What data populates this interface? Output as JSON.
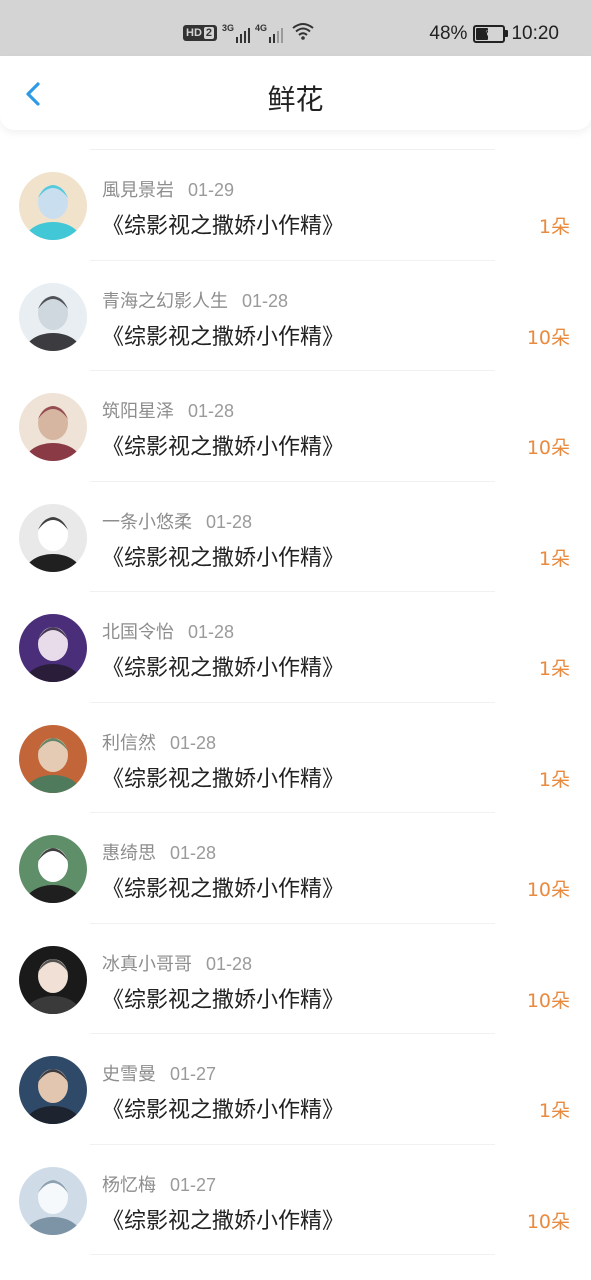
{
  "status_bar": {
    "hd_label": "HD",
    "hd_num": "2",
    "net1": "3G",
    "net2": "4G",
    "battery_pct": "48%",
    "battery_level": 0.48,
    "time": "10:20"
  },
  "header": {
    "title": "鲜花",
    "back_icon": "chevron-left-icon"
  },
  "accent_colors": {
    "back": "#2f9ae4",
    "count": "#e98a3f"
  },
  "items": [
    {
      "name": "風見景岩",
      "date": "01-29",
      "book": "《综影视之撒娇小作精》",
      "count": "1朵",
      "avatar_colors": [
        "#f1e2cc",
        "#c9dff0",
        "#41c7d6"
      ]
    },
    {
      "name": "青海之幻影人生",
      "date": "01-28",
      "book": "《综影视之撒娇小作精》",
      "count": "10朵",
      "avatar_colors": [
        "#e8eef2",
        "#cfd8df",
        "#3b3b40"
      ]
    },
    {
      "name": "筑阳星泽",
      "date": "01-28",
      "book": "《综影视之撒娇小作精》",
      "count": "10朵",
      "avatar_colors": [
        "#efe2d6",
        "#d6b6a0",
        "#8a3a44"
      ]
    },
    {
      "name": "一条小悠柔",
      "date": "01-28",
      "book": "《综影视之撒娇小作精》",
      "count": "1朵",
      "avatar_colors": [
        "#e9e9e9",
        "#ffffff",
        "#202020"
      ]
    },
    {
      "name": "北国令怡",
      "date": "01-28",
      "book": "《综影视之撒娇小作精》",
      "count": "1朵",
      "avatar_colors": [
        "#4a2e7a",
        "#e9dcea",
        "#2a1d3a"
      ]
    },
    {
      "name": "利信然",
      "date": "01-28",
      "book": "《综影视之撒娇小作精》",
      "count": "1朵",
      "avatar_colors": [
        "#c2663a",
        "#e6cbb4",
        "#4f7a5b"
      ]
    },
    {
      "name": "惠绮思",
      "date": "01-28",
      "book": "《综影视之撒娇小作精》",
      "count": "10朵",
      "avatar_colors": [
        "#5f8f69",
        "#ffffff",
        "#1f1f1f"
      ]
    },
    {
      "name": "冰真小哥哥",
      "date": "01-28",
      "book": "《综影视之撒娇小作精》",
      "count": "10朵",
      "avatar_colors": [
        "#1a1a1a",
        "#f0e0d6",
        "#3a3a3a"
      ]
    },
    {
      "name": "史雪曼",
      "date": "01-27",
      "book": "《综影视之撒娇小作精》",
      "count": "1朵",
      "avatar_colors": [
        "#2f4a68",
        "#e2c6b0",
        "#1d2430"
      ]
    },
    {
      "name": "杨忆梅",
      "date": "01-27",
      "book": "《综影视之撒娇小作精》",
      "count": "10朵",
      "avatar_colors": [
        "#cfdce8",
        "#f6f9fb",
        "#7d93a6"
      ]
    }
  ]
}
